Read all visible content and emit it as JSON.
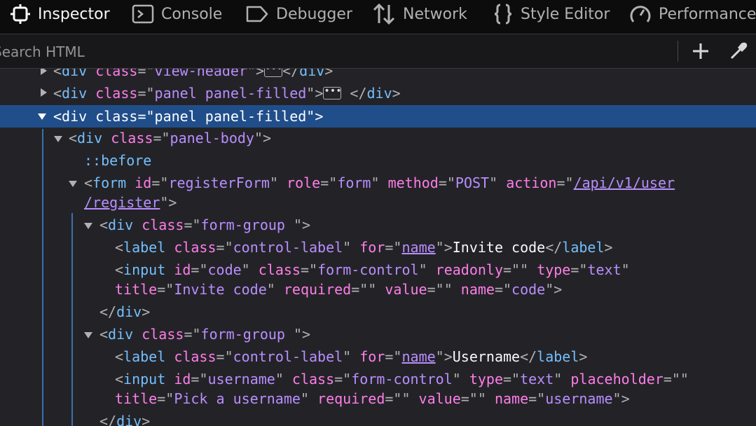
{
  "tabs": [
    {
      "label": "Inspector",
      "icon": "inspector-icon",
      "active": true
    },
    {
      "label": "Console",
      "icon": "console-icon"
    },
    {
      "label": "Debugger",
      "icon": "debugger-icon"
    },
    {
      "label": "Network",
      "icon": "network-icon"
    },
    {
      "label": "Style Editor",
      "icon": "style-editor-icon"
    },
    {
      "label": "Performance",
      "icon": "performance-icon"
    }
  ],
  "search": {
    "placeholder": "Search HTML"
  },
  "tree": {
    "l1": {
      "tag": "div",
      "a1": "class",
      "v1": "view-header",
      "ellipsis": "•••",
      "close": "div"
    },
    "l2": {
      "tag": "div",
      "a1": "class",
      "v1": "panel panel-filled",
      "ellipsis": "•••",
      "close": "div"
    },
    "l3": {
      "tag": "div",
      "a1": "class",
      "v1": "panel panel-filled"
    },
    "l4": {
      "tag": "div",
      "a1": "class",
      "v1": "panel-body"
    },
    "l5": {
      "pseudo": "::before"
    },
    "l6": {
      "tag": "form",
      "a1": "id",
      "v1": "registerForm",
      "a2": "role",
      "v2": "form",
      "a3": "method",
      "v3": "POST",
      "a4": "action",
      "v4a": "/api/v1/user",
      "v4b": "/register"
    },
    "l7": {
      "tag": "div",
      "a1": "class",
      "v1": "form-group "
    },
    "l8": {
      "tag": "label",
      "a1": "class",
      "v1": "control-label",
      "a2": "for",
      "v2": "name",
      "text": "Invite code",
      "close": "label"
    },
    "l9": {
      "tag": "input",
      "a1": "id",
      "v1": "code",
      "a2": "class",
      "v2": "form-control",
      "a3": "readonly",
      "v3": "",
      "a4": "type",
      "v4": "text"
    },
    "l10": {
      "a5": "title",
      "v5": "Invite code",
      "a6": "required",
      "v6": "",
      "a7": "value",
      "v7": "",
      "a8": "name",
      "v8": "code"
    },
    "l11": {
      "close": "div"
    },
    "l12": {
      "tag": "div",
      "a1": "class",
      "v1": "form-group "
    },
    "l13": {
      "tag": "label",
      "a1": "class",
      "v1": "control-label",
      "a2": "for",
      "v2": "name",
      "text": "Username",
      "close": "label"
    },
    "l14": {
      "tag": "input",
      "a1": "id",
      "v1": "username",
      "a2": "class",
      "v2": "form-control",
      "a3": "type",
      "v3": "text",
      "a4": "placeholder",
      "v4": ""
    },
    "l15": {
      "a5": "title",
      "v5": "Pick a username",
      "a6": "required",
      "v6": "",
      "a7": "value",
      "v7": "",
      "a8": "name",
      "v8": "username"
    },
    "l16": {
      "close": "div"
    }
  },
  "colors": {
    "selected_row": "#204e8a",
    "tag": "#75bfff",
    "attr_name": "#ff7de9",
    "attr_value": "#b98eff",
    "background": "#232327"
  }
}
